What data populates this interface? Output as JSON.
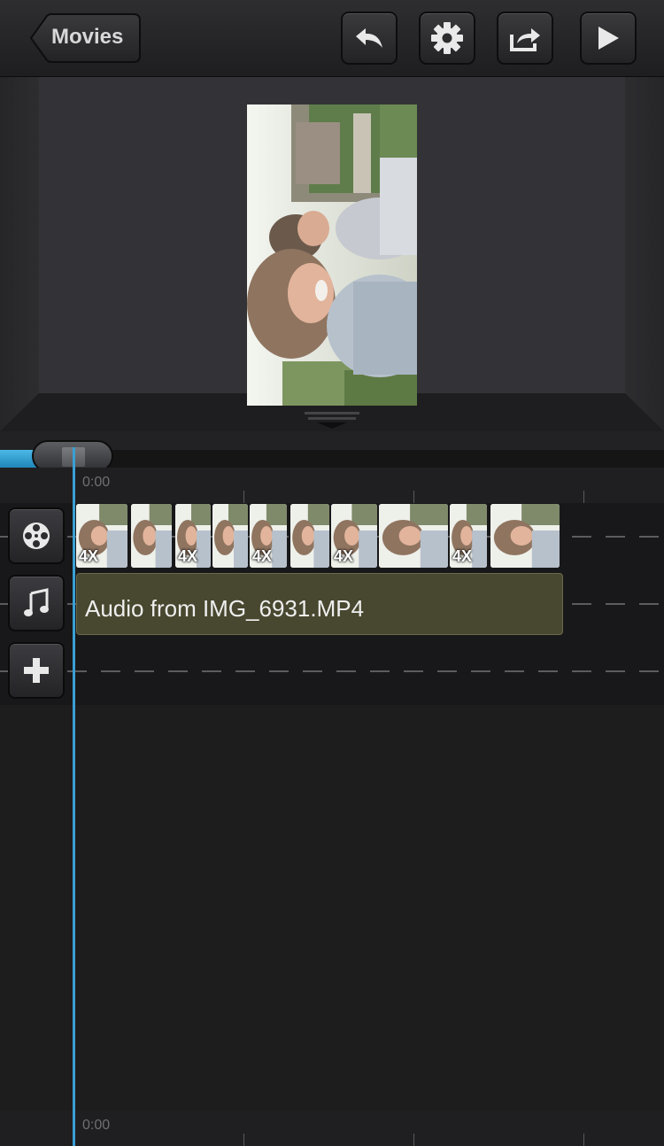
{
  "toolbar": {
    "back_label": "Movies",
    "buttons": [
      {
        "name": "undo",
        "icon": "undo-icon"
      },
      {
        "name": "settings",
        "icon": "gear-icon"
      },
      {
        "name": "share",
        "icon": "share-icon"
      },
      {
        "name": "play",
        "icon": "play-icon"
      }
    ]
  },
  "preview": {
    "content": "video-frame"
  },
  "scrubber": {
    "progress": 0.05
  },
  "timeline": {
    "start_time": "0:00",
    "footer_time": "0:00",
    "video_track": {
      "icon": "film-reel-icon",
      "clips": [
        {
          "badge": "4X"
        },
        {
          "badge": ""
        },
        {
          "badge": "4X"
        },
        {
          "badge": ""
        },
        {
          "badge": "4X"
        },
        {
          "badge": ""
        },
        {
          "badge": "4X"
        },
        {
          "badge": ""
        },
        {
          "badge": "4X"
        },
        {
          "badge": ""
        }
      ]
    },
    "audio_track": {
      "icon": "music-note-icon",
      "clip_label": "Audio from IMG_6931.MP4"
    },
    "add_track": {
      "icon": "plus-icon"
    }
  },
  "colors": {
    "accent": "#3b9fd4",
    "audio_clip": "#48472f",
    "background": "#1b1b1c"
  }
}
